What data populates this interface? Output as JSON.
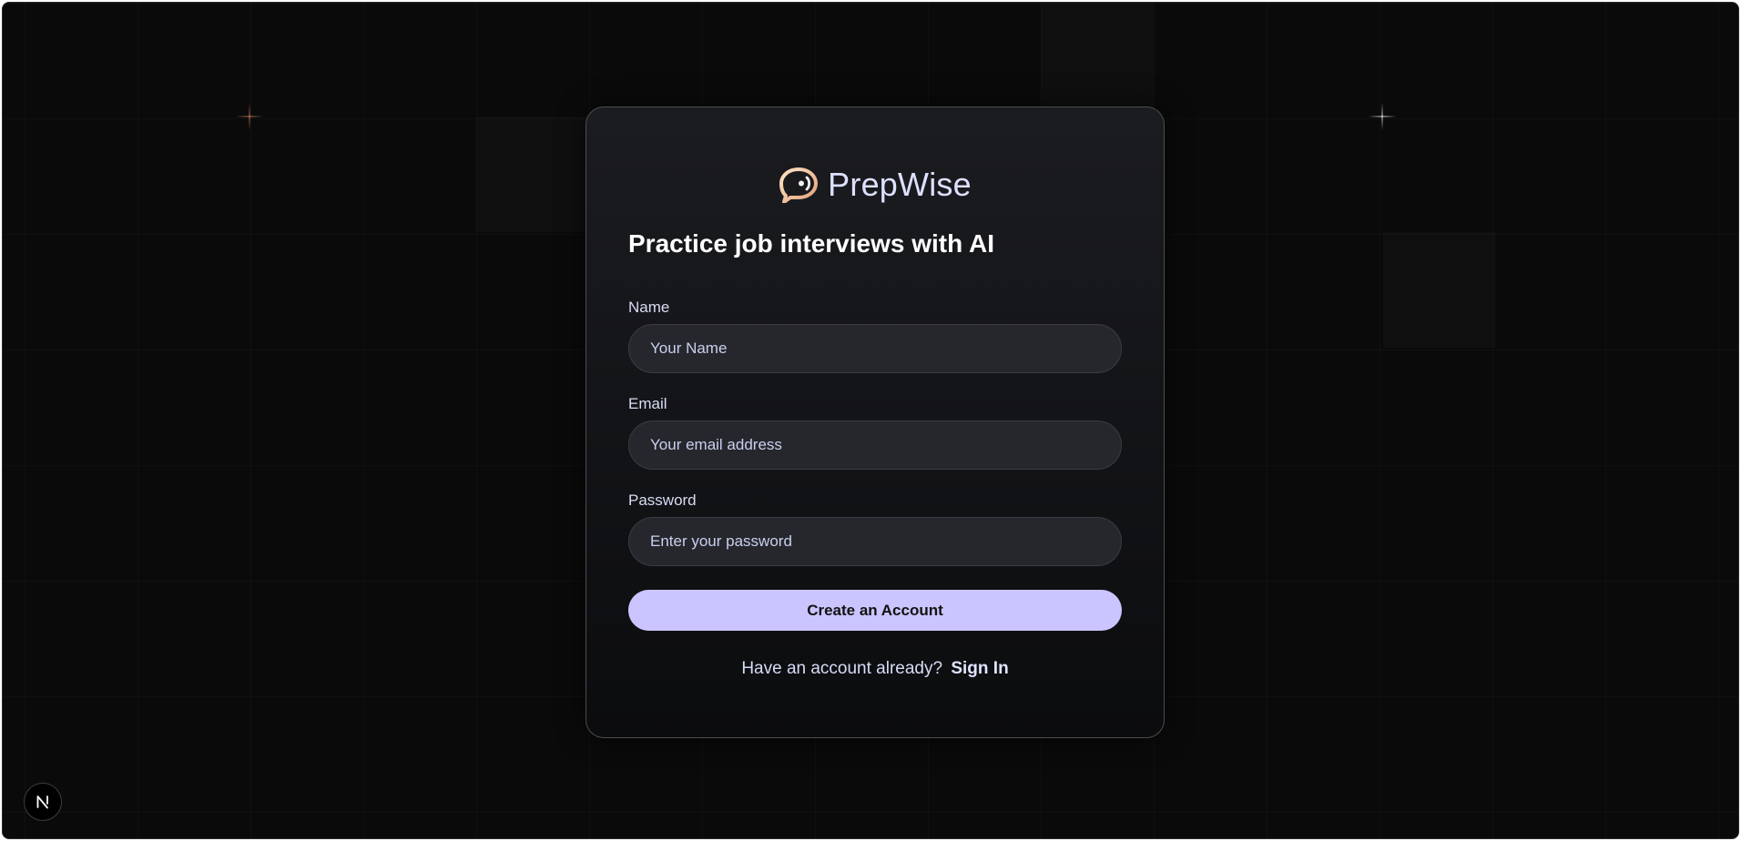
{
  "brand": {
    "name": "PrepWise",
    "icon": "chat-bubble-logo-icon",
    "accent_color": "#cac5fe",
    "logo_gradient": [
      "#fce2c3",
      "#e4a27a"
    ]
  },
  "auth": {
    "headline": "Practice job interviews with AI",
    "fields": [
      {
        "label": "Name",
        "placeholder": "Your Name",
        "value": "",
        "type": "text"
      },
      {
        "label": "Email",
        "placeholder": "Your email address",
        "value": "",
        "type": "email"
      },
      {
        "label": "Password",
        "placeholder": "Enter your password",
        "value": "",
        "type": "password"
      }
    ],
    "submit_label": "Create an Account",
    "switch_prompt": "Have an account already?",
    "switch_link": "Sign In"
  },
  "dev_badge": {
    "letter": "N",
    "icon": "nextjs-logo-icon"
  }
}
